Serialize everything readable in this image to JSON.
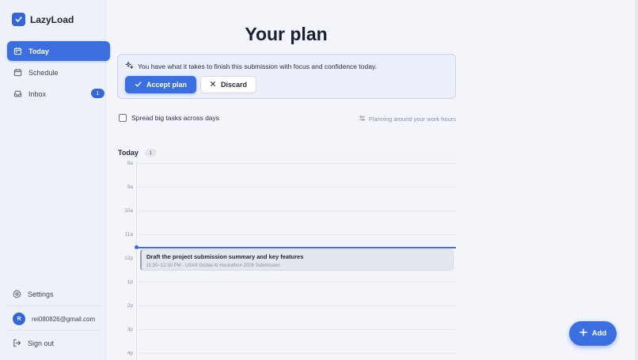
{
  "app": {
    "name": "LazyLoad"
  },
  "sidebar": {
    "nav": [
      {
        "label": "Today",
        "icon": "calendar-today-icon",
        "active": true
      },
      {
        "label": "Schedule",
        "icon": "calendar-icon",
        "active": false
      },
      {
        "label": "Inbox",
        "icon": "inbox-icon",
        "active": false,
        "badge": "1"
      }
    ],
    "settings_label": "Settings",
    "user": {
      "avatar_initial": "R",
      "email": "rei080826@gmail.com"
    },
    "sign_out_label": "Sign out"
  },
  "main": {
    "title": "Your plan",
    "banner": {
      "message": "You have what it takes to finish this submission with focus and confidence today.",
      "accept_label": "Accept plan",
      "discard_label": "Discard"
    },
    "spread_label": "Spread big tasks across days",
    "work_hours_label": "Planning around your work hours",
    "day": {
      "label": "Today",
      "count": "1"
    },
    "hours": [
      "8a",
      "9a",
      "10a",
      "11a",
      "12p",
      "1p",
      "2p",
      "3p",
      "4p"
    ],
    "event": {
      "title": "Draft the project submission summary and key features",
      "meta": "11:30–12:30 PM · USAII Global AI Hackathon 2026 Submission"
    },
    "add_label": "Add"
  },
  "colors": {
    "accent": "#3b6fe0",
    "sidebar_bg": "#eef1f8",
    "page_bg": "#f3f5fb"
  }
}
